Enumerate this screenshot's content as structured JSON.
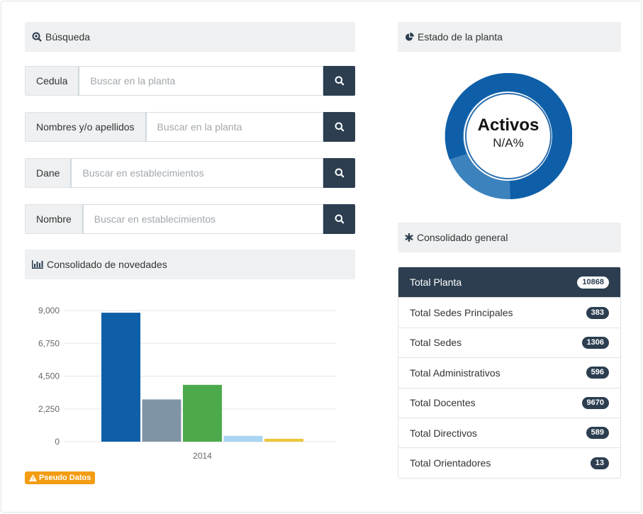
{
  "search": {
    "header": "Búsqueda",
    "rows": [
      {
        "label": "Cedula",
        "placeholder": "Buscar en la planta"
      },
      {
        "label": "Nombres y/o apellidos",
        "placeholder": "Buscar en la planta"
      },
      {
        "label": "Dane",
        "placeholder": "Buscar en establecimientos"
      },
      {
        "label": "Nombre",
        "placeholder": "Buscar en establecimientos"
      }
    ]
  },
  "novedades": {
    "header": "Consolidado de novedades",
    "badge": "Pseudo Datos"
  },
  "chart_data": {
    "type": "bar",
    "categories": [
      "2014"
    ],
    "series": [
      {
        "values": [
          8850
        ],
        "color": "#0e5fa8"
      },
      {
        "values": [
          2900
        ],
        "color": "#7f95a6"
      },
      {
        "values": [
          3900
        ],
        "color": "#4caa4c"
      },
      {
        "values": [
          400
        ],
        "color": "#a9d4f2"
      },
      {
        "values": [
          200
        ],
        "color": "#ecc53b"
      }
    ],
    "yticks": [
      "9,000",
      "6,750",
      "4,500",
      "2,250",
      "0"
    ],
    "ylim": [
      0,
      9000
    ],
    "grid": true
  },
  "planta": {
    "header": "Estado de la planta",
    "donut_title": "Activos",
    "donut_value": "N/A%",
    "colors": {
      "primary": "#0e5fa8",
      "secondary": "#3c82bd"
    }
  },
  "consolidado": {
    "header": "Consolidado general",
    "items": [
      {
        "label": "Total Planta",
        "count": "10868"
      },
      {
        "label": "Total Sedes Principales",
        "count": "383"
      },
      {
        "label": "Total Sedes",
        "count": "1306"
      },
      {
        "label": "Total Administrativos",
        "count": "596"
      },
      {
        "label": "Total Docentes",
        "count": "9670"
      },
      {
        "label": "Total Directivos",
        "count": "589"
      },
      {
        "label": "Total Orientadores",
        "count": "13"
      }
    ]
  }
}
